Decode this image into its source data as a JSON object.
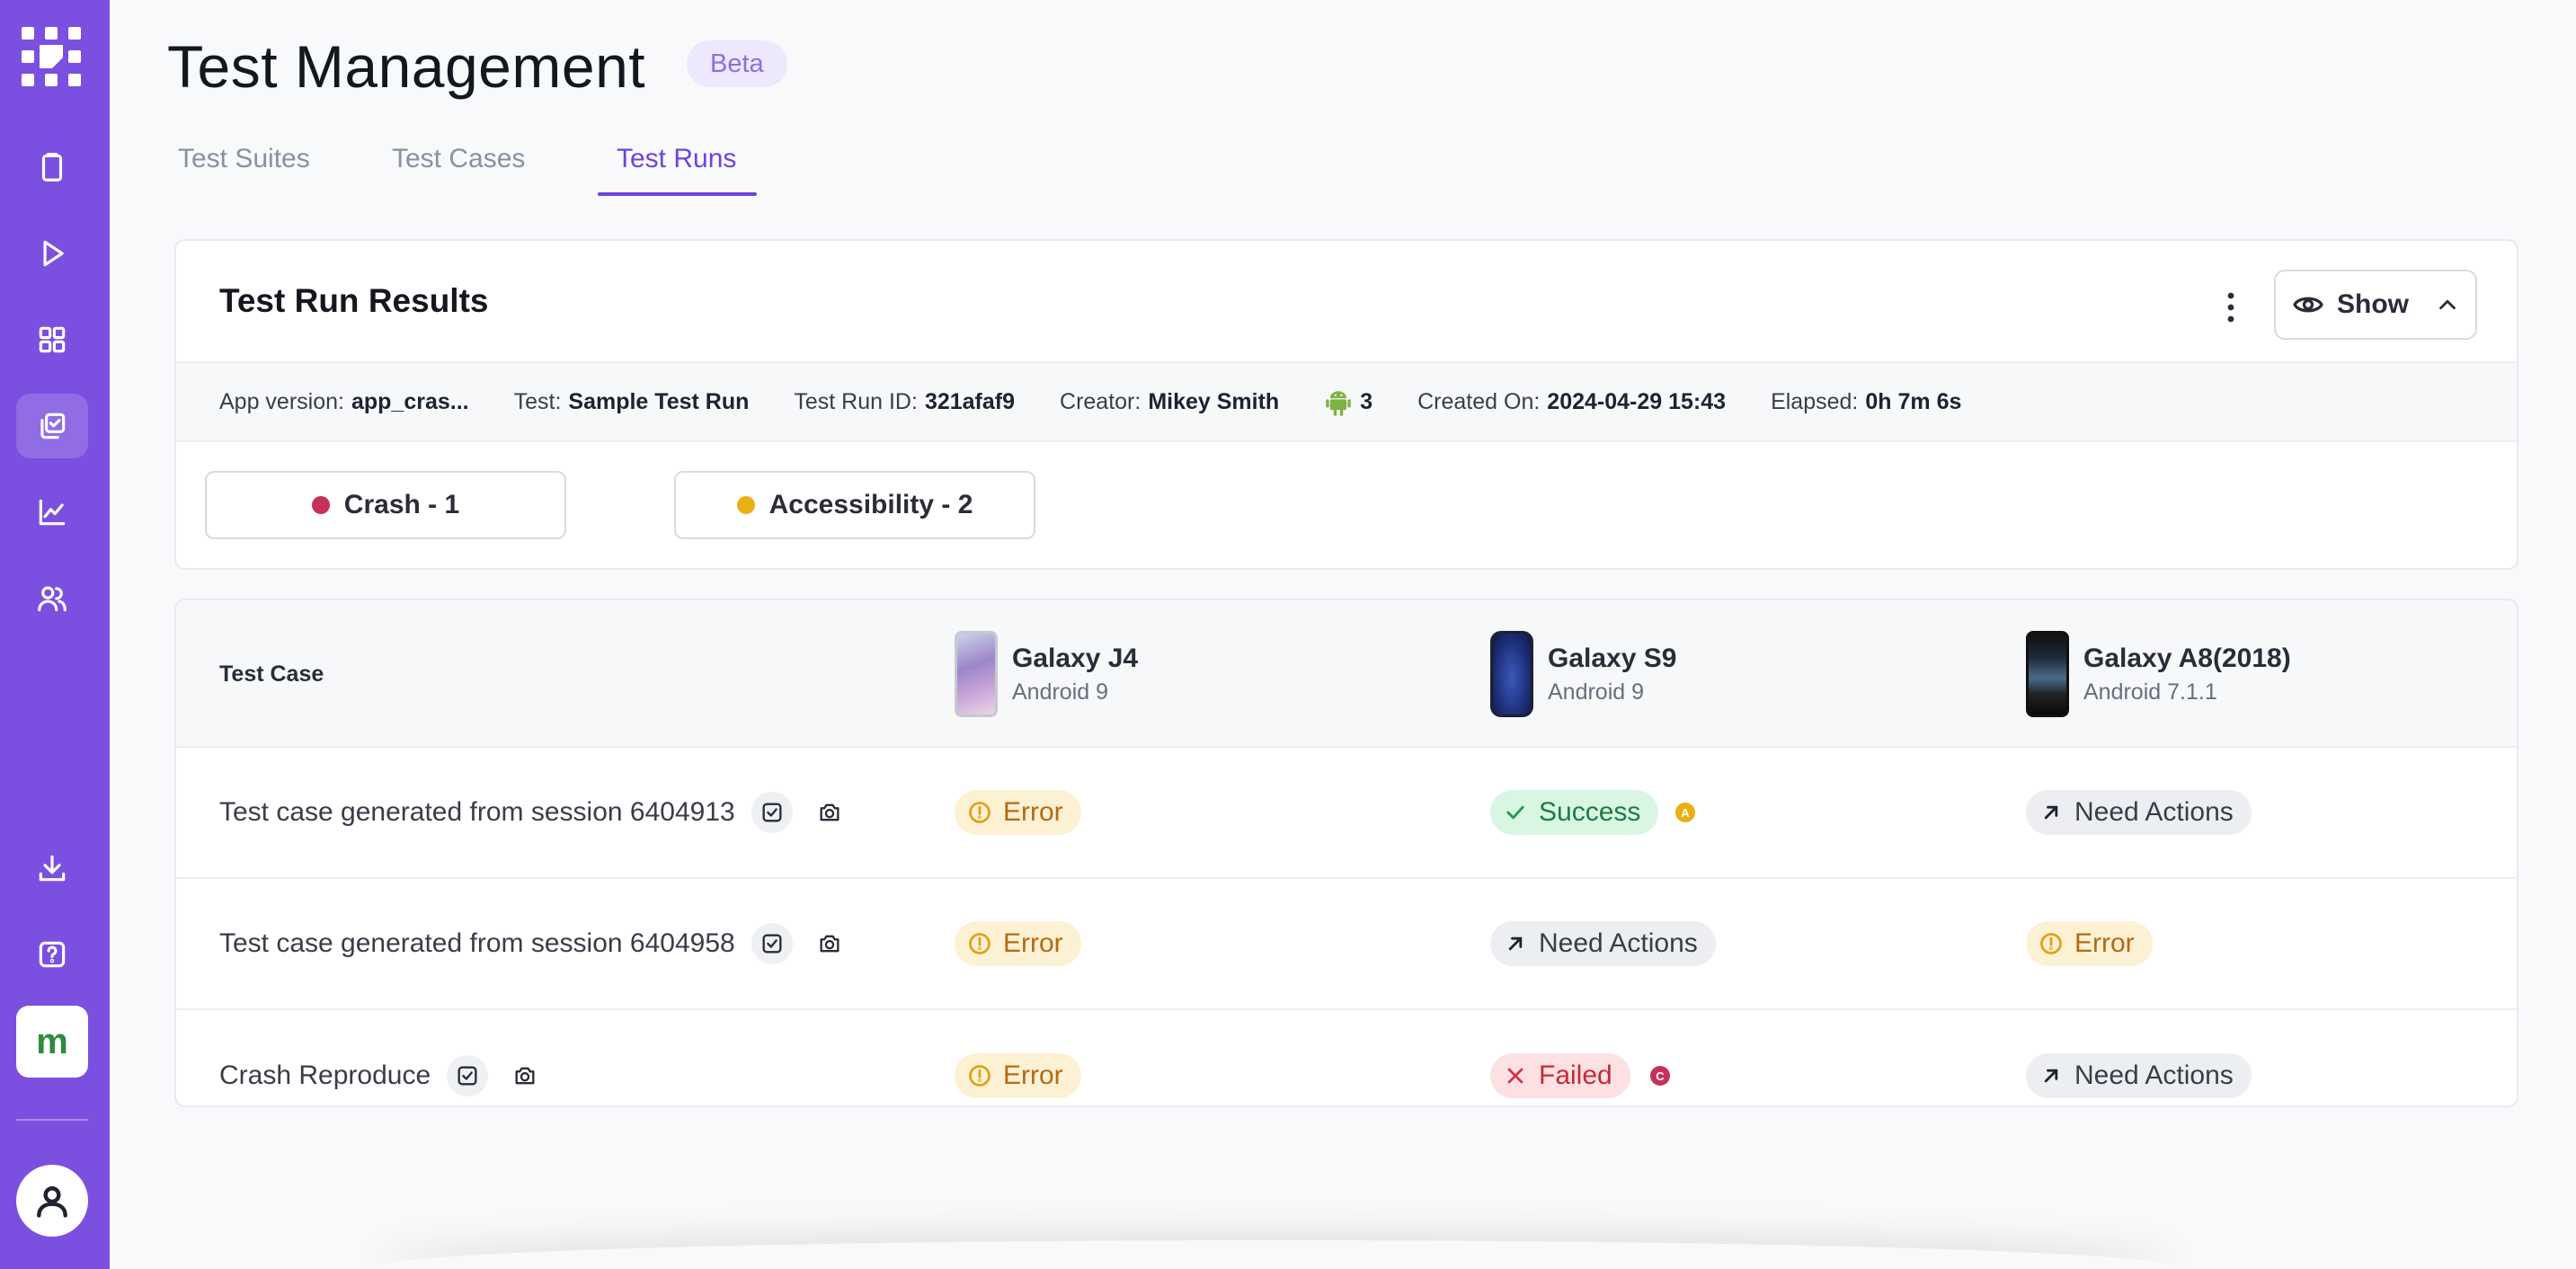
{
  "header": {
    "title": "Test Management",
    "badge": "Beta"
  },
  "tabs": [
    {
      "label": "Test Suites"
    },
    {
      "label": "Test Cases"
    },
    {
      "label": "Test Runs",
      "active": true
    }
  ],
  "results": {
    "title": "Test Run Results",
    "show_label": "Show",
    "meta": {
      "app_version_label": "App version:",
      "app_version": "app_cras...",
      "test_label": "Test:",
      "test": "Sample Test Run",
      "run_id_label": "Test Run ID:",
      "run_id": "321afaf9",
      "creator_label": "Creator:",
      "creator": "Mikey Smith",
      "android_count": "3",
      "created_label": "Created On:",
      "created": "2024-04-29 15:43",
      "elapsed_label": "Elapsed:",
      "elapsed": "0h 7m 6s"
    },
    "issues": [
      {
        "label": "Crash - 1",
        "color": "#c7305a"
      },
      {
        "label": "Accessibility - 2",
        "color": "#e8b013"
      }
    ]
  },
  "table": {
    "col_label": "Test Case",
    "devices": [
      {
        "name": "Galaxy J4",
        "os": "Android 9"
      },
      {
        "name": "Galaxy S9",
        "os": "Android 9"
      },
      {
        "name": "Galaxy A8(2018)",
        "os": "Android 7.1.1"
      }
    ],
    "rows": [
      {
        "name": "Test case generated from session 6404913",
        "results": [
          "Error",
          "Success",
          "Need Actions"
        ],
        "badge": "A"
      },
      {
        "name": "Test case generated from session 6404958",
        "results": [
          "Error",
          "Need Actions",
          "Error"
        ]
      },
      {
        "name": "Crash Reproduce",
        "results": [
          "Error",
          "Failed",
          "Need Actions"
        ],
        "badge": "C"
      }
    ]
  },
  "sidebar": {
    "items": [
      "clipboard-icon",
      "play-icon",
      "grid-icon",
      "test-runs-icon",
      "chart-icon",
      "users-icon",
      "download-icon",
      "help-icon"
    ],
    "brand": "m"
  }
}
